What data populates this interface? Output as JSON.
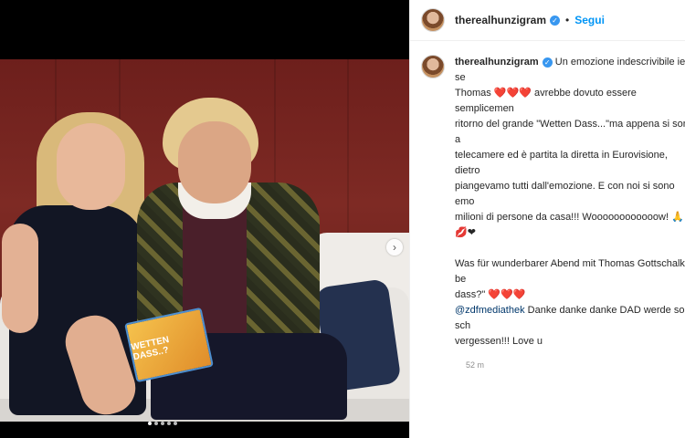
{
  "header": {
    "username": "therealhunzigram",
    "separator": "•",
    "follow_label": "Segui"
  },
  "caption": {
    "username": "therealhunzigram",
    "line1": "Un emozione indescrivibile ieri se",
    "line2a": "Thomas",
    "hearts": "❤️❤️❤️",
    "line2b": " avrebbe dovuto essere semplicemen",
    "line3": "ritorno del grande \"Wetten Dass...\"ma appena si sono a",
    "line4": "telecamere ed è partita la diretta in Eurovisione, dietro",
    "line5": "piangevamo tutti dall'emozione. E con noi si sono emo",
    "line6": "milioni di persone da casa!!! Woooooooooooow! 🙏💋❤",
    "para2_line1": "Was für wunderbarer Abend mit Thomas Gottschalk be",
    "para2_line2": "dass?\"",
    "para2_hearts": "❤️❤️❤️",
    "mention": "@zdfmediathek",
    "para2_line3": " Danke danke danke DAD werde so sch",
    "para2_line4": "vergessen!!! Love u",
    "time": "52 m"
  },
  "media": {
    "card_text": "WETTEN DASS..?",
    "next_icon": "›"
  },
  "colors": {
    "link": "#0095f6",
    "verified": "#3897f0",
    "heart": "#e0245e"
  }
}
